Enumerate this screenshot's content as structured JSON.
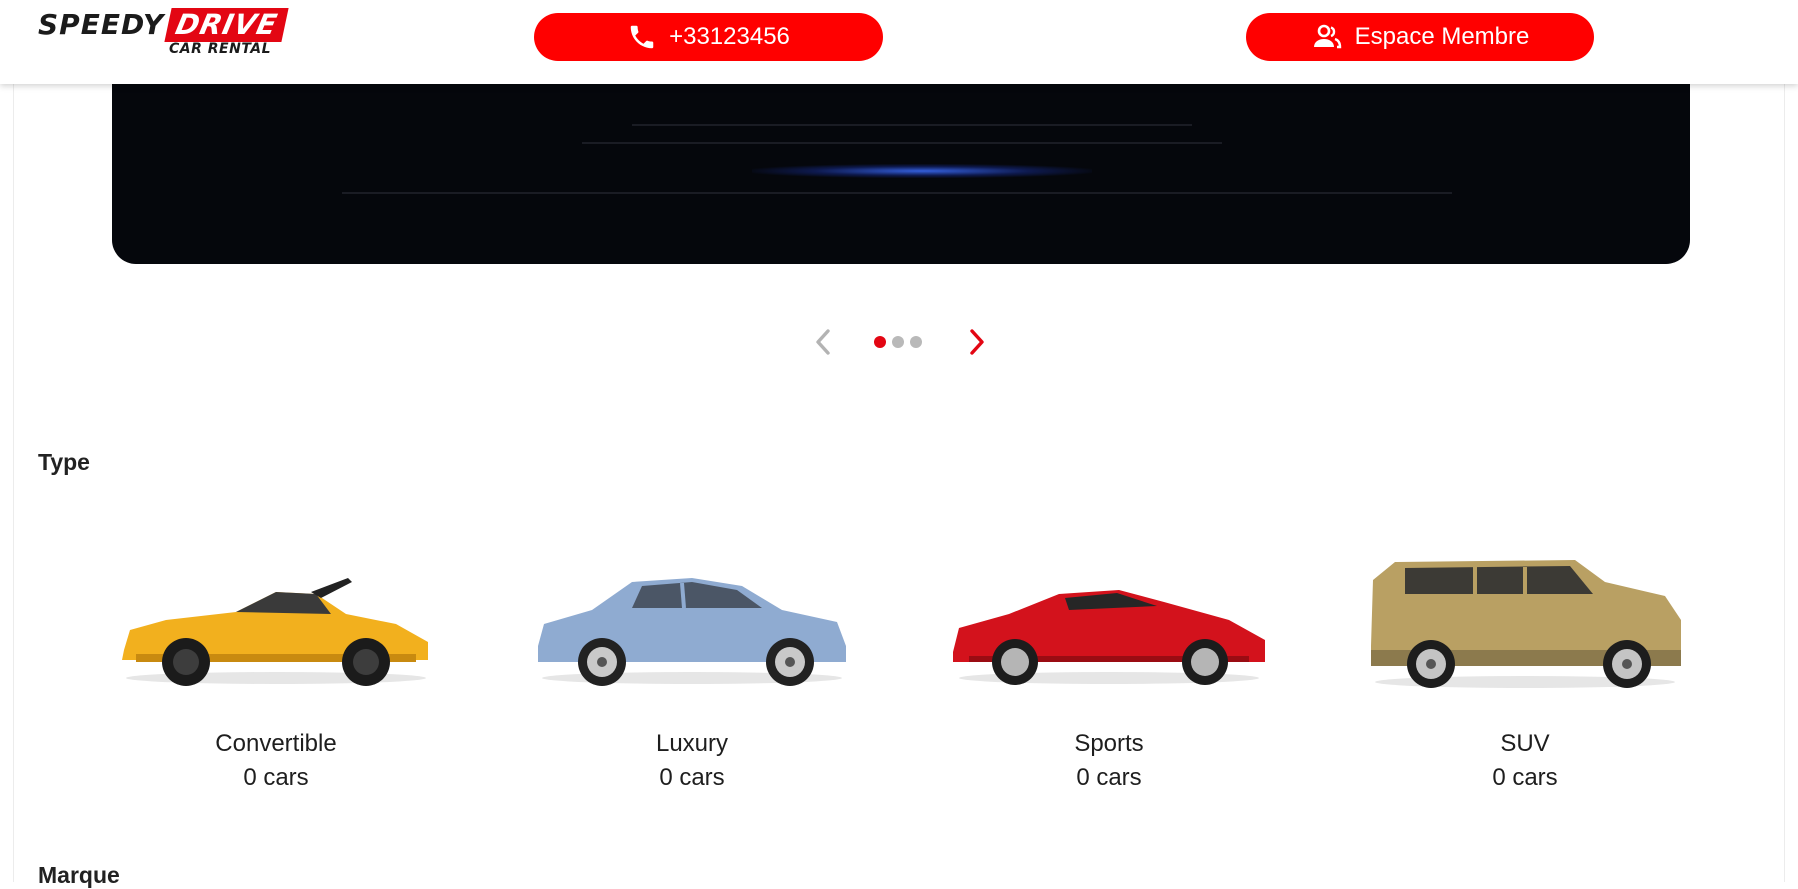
{
  "header": {
    "logo": {
      "brand_left": "SPEEDY",
      "brand_right": "DRIVE",
      "tagline": "CAR RENTAL"
    },
    "phone_button": {
      "label": "+33123456",
      "icon": "phone-icon"
    },
    "member_button": {
      "label": "Espace Membre",
      "icon": "users-icon"
    }
  },
  "carousel": {
    "slide_count": 3,
    "active_index": 0,
    "prev_icon": "chevron-left-icon",
    "next_icon": "chevron-right-icon"
  },
  "type_section": {
    "title": "Type",
    "items": [
      {
        "name": "Convertible",
        "count": "0 cars",
        "color": "#f2b01e"
      },
      {
        "name": "Luxury",
        "count": "0 cars",
        "color": "#8fabd1"
      },
      {
        "name": "Sports",
        "count": "0 cars",
        "color": "#d3121c"
      },
      {
        "name": "SUV",
        "count": "0 cars",
        "color": "#b9a063"
      }
    ]
  },
  "marque_section": {
    "title": "Marque"
  },
  "colors": {
    "accent": "#ff0000",
    "brand_red": "#e30613",
    "dot_inactive": "#b9b9b9"
  }
}
